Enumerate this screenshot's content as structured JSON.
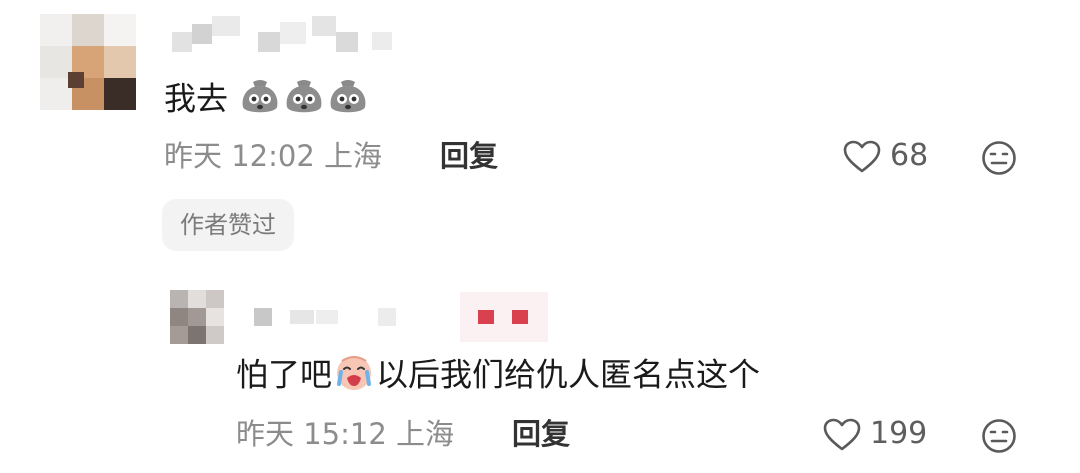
{
  "comments": [
    {
      "text": "我去",
      "emojis": [
        "sack-emoji",
        "sack-emoji",
        "sack-emoji"
      ],
      "date": "昨天",
      "time": "12:02",
      "location": "上海",
      "reply_label": "回复",
      "likes": "68",
      "badge": "作者赞过"
    },
    {
      "text_before": "怕了吧",
      "emoji": "crying-face-emoji",
      "text_after": "以后我们给仇人匿名点这个",
      "date": "昨天",
      "time": "15:12",
      "location": "上海",
      "reply_label": "回复",
      "likes": "199"
    }
  ],
  "colors": {
    "text": "#1a1a1a",
    "meta": "#8c8c8c",
    "badge_bg": "#f3f3f3",
    "author_tag": "#d9414f"
  }
}
